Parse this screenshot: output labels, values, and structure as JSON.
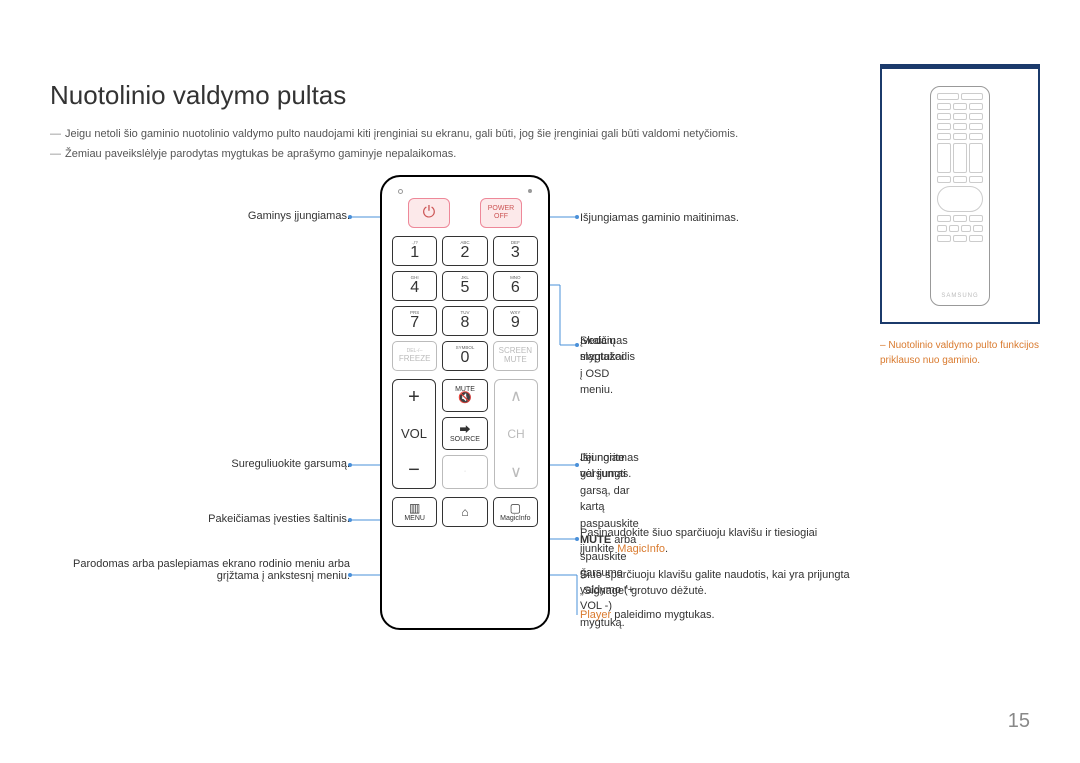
{
  "title": "Nuotolinio valdymo pultas",
  "notes": {
    "n1": "Jeigu netoli šio gaminio nuotolinio valdymo pulto naudojami kiti įrenginiai su ekranu, gali būti, jog šie įrenginiai gali būti valdomi netyčiomis.",
    "n2": "Žemiau paveikslėlyje parodytas mygtukas be aprašymo gaminyje nepalaikomas."
  },
  "left": {
    "power_on": "Gaminys įjungiamas.",
    "volume": "Sureguliuokite garsumą.",
    "source": "Pakeičiamas įvesties šaltinis.",
    "menu": "Parodomas arba paslepiamas ekrano rodinio meniu arba grįžtama į ankstesnį meniu."
  },
  "right": {
    "power_off": "Išjungiamas gaminio maitinimas.",
    "numbers_title": "Skaičių mygtukai",
    "numbers_sub": "Įvedamas slaptažodis į OSD meniu.",
    "mute_title": "Išjungiamas garsumas.",
    "mute_sub_a": "Jei norite vėl įjungti garsą, dar kartą paspauskite ",
    "mute_bold": "MUTE",
    "mute_sub_b": " arba spauskite garsumo valdymo (+ VOL -) mygtuką.",
    "magicinfo_a": "Pasinaudokite šiuo sparčiuoju klavišu ir tiesiogiai įjunkite ",
    "magicinfo_orange": "MagicInfo",
    "magicinfo_b": ".",
    "home": "Šiuo sparčiuoju klavišu galite naudotis, kai yra prijungta „Signage\" grotuvo dėžutė.",
    "player_orange": "Player",
    "player_rest": " paleidimo mygtukas."
  },
  "side_note": "Nuotolinio valdymo pulto funkcijos priklauso nuo gaminio.",
  "remote": {
    "power_off": "POWER OFF",
    "keys": {
      "k1": {
        "sub": ".,!?",
        "num": "1"
      },
      "k2": {
        "sub": "ABC",
        "num": "2"
      },
      "k3": {
        "sub": "DEF",
        "num": "3"
      },
      "k4": {
        "sub": "GHI",
        "num": "4"
      },
      "k5": {
        "sub": "JKL",
        "num": "5"
      },
      "k6": {
        "sub": "MNO",
        "num": "6"
      },
      "k7": {
        "sub": "PRS",
        "num": "7"
      },
      "k8": {
        "sub": "TUV",
        "num": "8"
      },
      "k9": {
        "sub": "WXY",
        "num": "9"
      },
      "freeze": {
        "sub": "DEL-/--",
        "mid": "FREEZE"
      },
      "k0": {
        "sub": "SYMBOL",
        "num": "0"
      },
      "screen": {
        "sub": "",
        "mid": "SCREEN MUTE"
      }
    },
    "vol": "VOL",
    "ch": "CH",
    "mute": "MUTE",
    "source": "SOURCE",
    "menu": "MENU",
    "home": "⌂",
    "magicinfo": "MagicInfo",
    "brand": "SAMSUNG"
  },
  "page_number": "15"
}
